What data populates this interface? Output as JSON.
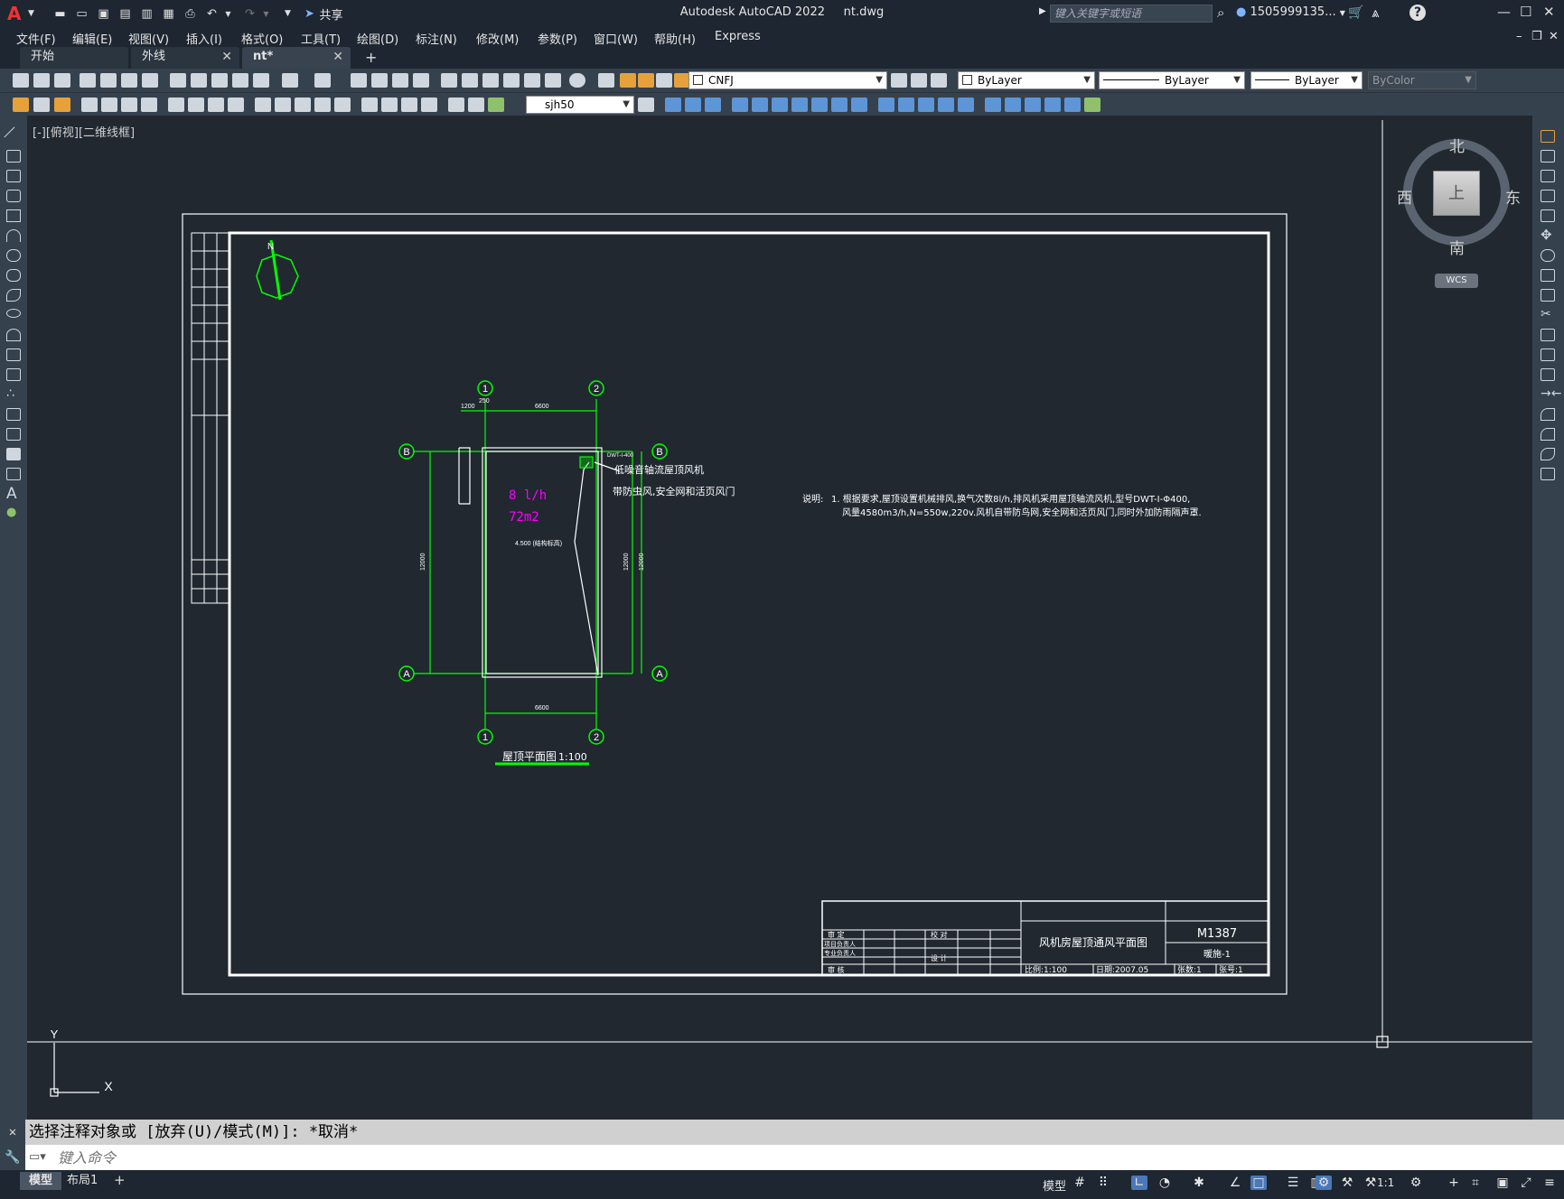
{
  "titlebar": {
    "app_title": "Autodesk AutoCAD 2022",
    "file_name": "nt.dwg",
    "share_label": "共享",
    "search_placeholder": "键入关键字或短语",
    "user_label": "1505999135...",
    "icons": [
      "logo-a-icon",
      "new-icon",
      "open-icon",
      "save-icon",
      "save-as-icon",
      "export-icon",
      "plot-icon",
      "undo-icon",
      "redo-icon",
      "share-icon",
      "search-icon",
      "user-icon",
      "cart-icon",
      "autodesk-icon",
      "help-icon"
    ]
  },
  "menu": {
    "items": [
      "文件(F)",
      "编辑(E)",
      "视图(V)",
      "插入(I)",
      "格式(O)",
      "工具(T)",
      "绘图(D)",
      "标注(N)",
      "修改(M)",
      "参数(P)",
      "窗口(W)",
      "帮助(H)",
      "Express"
    ]
  },
  "tabs": [
    {
      "label": "开始",
      "active": false
    },
    {
      "label": "外线",
      "active": false
    },
    {
      "label": "nt*",
      "active": true
    }
  ],
  "toolbar": {
    "layer_value": "CNFJ",
    "color_value": "ByLayer",
    "linetype_value": "ByLayer",
    "lineweight_value": "ByLayer",
    "plotstyle_value": "ByColor",
    "dimstyle_value": "sjh50"
  },
  "viewport": {
    "label": "[-][俯视][二维线框]"
  },
  "viewcube": {
    "north": "北",
    "south": "南",
    "east": "东",
    "west": "西",
    "face": "上",
    "wcs_label": "WCS"
  },
  "drawing": {
    "colors": {
      "line": "#ffffff",
      "dim": "#00ff00",
      "text_magenta": "#ff00ff",
      "bg": "#212830"
    },
    "axis_top_1": "1",
    "axis_top_2": "2",
    "axis_bot_1": "1",
    "axis_bot_2": "2",
    "axis_left_b": "B",
    "axis_left_a": "A",
    "axis_right_b": "B",
    "axis_right_a": "A",
    "dim_top_a": "1200",
    "dim_top_b": "250",
    "dim_top_c": "6600",
    "dim_bottom": "6600",
    "dim_left": "12000",
    "dim_right_a": "12000",
    "dim_right_b": "12000",
    "flow": "8 l/h",
    "area": "72m2",
    "elevation": "4.500 (结构标高)",
    "fan_label_1": "低噪音轴流屋顶风机",
    "fan_label_2": "带防虫风,安全网和活页风门",
    "fan_tag": "DWT-I-400",
    "plan_title": "屋顶平面图",
    "plan_scale": "1:100",
    "note_label": "说明:",
    "note_line_1": "1. 根据要求,屋顶设置机械排风,换气次数8l/h,排风机采用屋顶轴流风机,型号DWT-I-Φ400,",
    "note_line_2": "风量4580m3/h,N=550w,220v.风机自带防鸟网,安全网和活页风门,同时外加防雨隔声罩.",
    "titleblock": {
      "project_title": "风机房屋顶通风平面图",
      "drawing_no": "M1387",
      "sheet_code": "暖施-1",
      "scale": "比例:1:100",
      "date": "日期:2007.05",
      "sheet_total": "张数:1",
      "sheet_no": "张号:1",
      "row_approve": "审  定",
      "row_pm": "项目负责人",
      "row_lead": "专业负责人",
      "row_review": "审  核",
      "row_check": "校  对",
      "row_design": "设  计"
    }
  },
  "command": {
    "history": "选择注释对象或 [放弃(U)/模式(M)]: *取消*",
    "placeholder": "键入命令"
  },
  "statusbar": {
    "layout_tabs": [
      "模型",
      "布局1"
    ],
    "model_label": "模型",
    "scale": "1:1"
  }
}
